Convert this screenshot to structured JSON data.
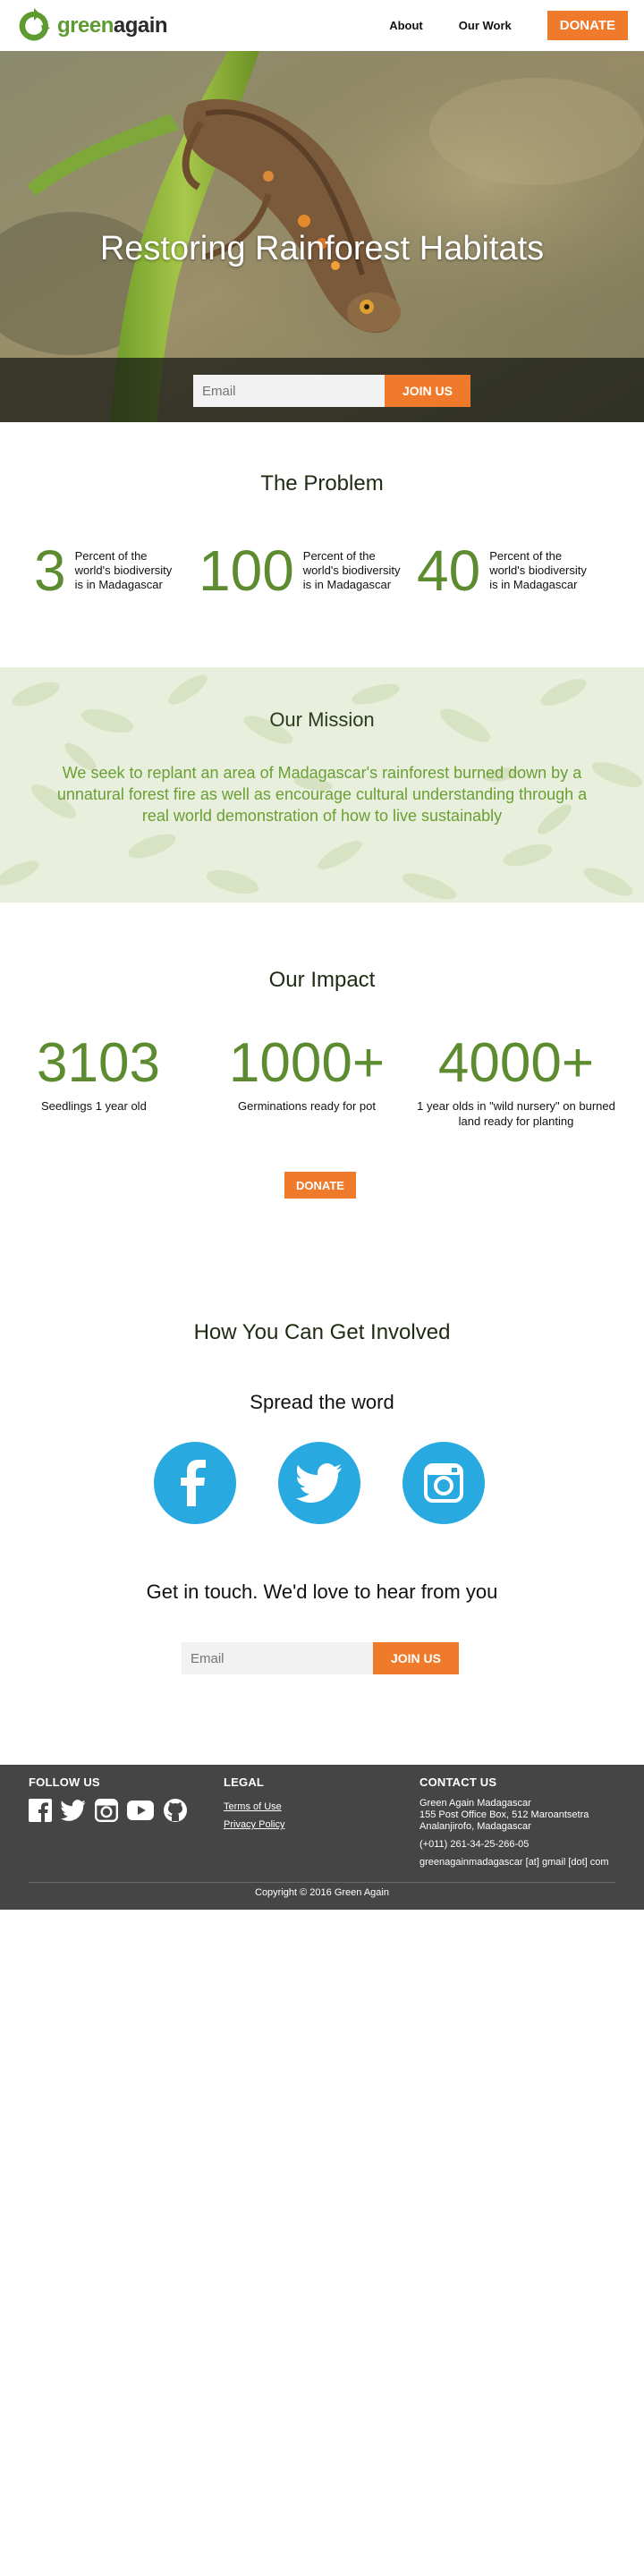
{
  "header": {
    "logo_green": "green",
    "logo_dark": "again",
    "nav": [
      "About",
      "Our Work"
    ],
    "donate_label": "DONATE"
  },
  "hero": {
    "title": "Restoring Rainforest Habitats",
    "email_placeholder": "Email",
    "join_label": "JOIN US"
  },
  "problem": {
    "title": "The Problem",
    "stats": [
      {
        "number": "3",
        "label": "Percent of the world's biodiversity is in Madagascar"
      },
      {
        "number": "100",
        "label": "Percent of the world's biodiversity is in Madagascar"
      },
      {
        "number": "40",
        "label": "Percent of the world's biodiversity is in Madagascar"
      }
    ]
  },
  "mission": {
    "title": "Our Mission",
    "text": "We seek to replant an area of Madagascar's rainforest burned down by a unnatural forest fire as well as encourage cultural understanding through a real world demonstration of how to live sustainably"
  },
  "impact": {
    "title": "Our Impact",
    "stats": [
      {
        "number": "3103",
        "label": "Seedlings 1 year old"
      },
      {
        "number": "1000+",
        "label": "Germinations ready for pot"
      },
      {
        "number": "4000+",
        "label": "1 year olds in \"wild nursery\" on burned land ready for planting"
      }
    ],
    "donate_label": "DONATE"
  },
  "involved": {
    "title": "How You Can Get Involved",
    "spread_title": "Spread the word",
    "social": [
      "facebook-icon",
      "twitter-icon",
      "instagram-icon"
    ],
    "contact_title": "Get in touch. We'd love to hear from you",
    "email_placeholder": "Email",
    "join_label": "JOIN US"
  },
  "footer": {
    "follow_heading": "FOLLOW US",
    "follow_icons": [
      "facebook-icon",
      "twitter-icon",
      "instagram-icon",
      "youtube-icon",
      "github-icon"
    ],
    "legal_heading": "LEGAL",
    "legal_links": [
      "Terms of Use",
      "Privacy Policy"
    ],
    "contact_heading": "CONTACT US",
    "contact_name": "Green Again Madagascar",
    "contact_address_1": "155 Post Office Box, 512 Maroantsetra",
    "contact_address_2": "Analanjirofo, Madagascar",
    "contact_phone": "(+011) 261-34-25-266-05",
    "contact_email": "greenagainmadagascar [at] gmail [dot] com",
    "copyright": "Copyright © 2016 Green Again"
  },
  "colors": {
    "brand_green": "#5d8b2f",
    "accent_orange": "#f07a2b",
    "social_blue": "#28a9e0",
    "footer_bg": "#454545"
  }
}
